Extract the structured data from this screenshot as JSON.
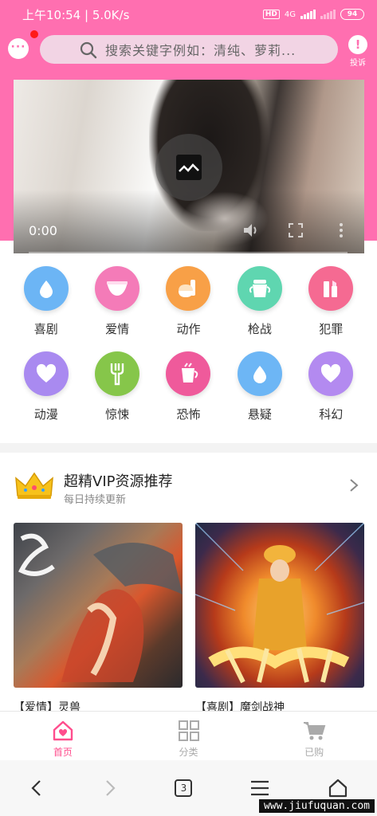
{
  "status_bar": {
    "time": "上午10:54 | 5.0K/s",
    "hd": "HD",
    "network": "4G",
    "battery": "94"
  },
  "header": {
    "search_placeholder": "搜索关键字例如：清纯、萝莉...",
    "report_label": "投诉"
  },
  "video": {
    "time": "0:00"
  },
  "categories": [
    {
      "label": "喜剧",
      "color": "#6cb5f5",
      "icon": "drop-icon"
    },
    {
      "label": "爱情",
      "color": "#f47bb8",
      "icon": "diaper-icon"
    },
    {
      "label": "动作",
      "color": "#f8a047",
      "icon": "bottle-icon"
    },
    {
      "label": "枪战",
      "color": "#5fd6b0",
      "icon": "cup-icon"
    },
    {
      "label": "犯罪",
      "color": "#f56a92",
      "icon": "lipstick-icon"
    },
    {
      "label": "动漫",
      "color": "#a98af0",
      "icon": "heart-icon"
    },
    {
      "label": "惊悚",
      "color": "#86c64a",
      "icon": "fork-icon"
    },
    {
      "label": "恐怖",
      "color": "#ef5a9b",
      "icon": "glass-icon"
    },
    {
      "label": "悬疑",
      "color": "#6db6f5",
      "icon": "drop-icon"
    },
    {
      "label": "科幻",
      "color": "#b38af0",
      "icon": "heart-icon"
    }
  ],
  "vip": {
    "title": "超精VIP资源推荐",
    "subtitle": "每日持续更新"
  },
  "posters": [
    {
      "caption": "【爱情】灵兽"
    },
    {
      "caption": "【喜剧】魔剑战神"
    }
  ],
  "tabbar": [
    {
      "label": "首页",
      "active": true
    },
    {
      "label": "分类",
      "active": false
    },
    {
      "label": "已购",
      "active": false
    }
  ],
  "browser": {
    "tab_count": "3"
  },
  "watermark": "www.jiufuquan.com",
  "colors": {
    "brand": "#ff6fb0",
    "active": "#ff4d8d"
  }
}
